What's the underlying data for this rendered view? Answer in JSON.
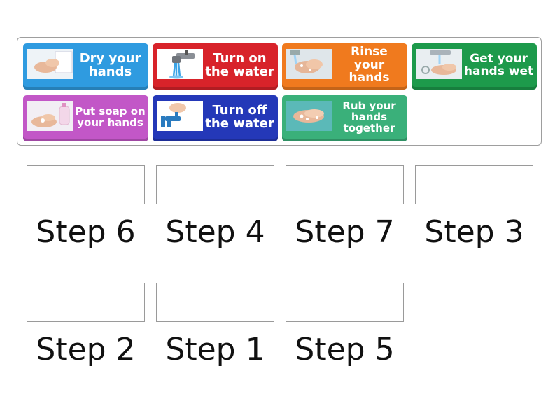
{
  "tiles": [
    {
      "label": "Dry your hands",
      "color": "#2f9be0",
      "icon": "dry-hands-icon"
    },
    {
      "label": "Turn on the water",
      "color": "#d8232a",
      "icon": "faucet-on-icon"
    },
    {
      "label": "Rinse your hands",
      "color": "#f07a1e",
      "icon": "rinse-hands-icon"
    },
    {
      "label": "Get your hands wet",
      "color": "#1d9a4b",
      "icon": "wet-hands-icon"
    },
    {
      "label": "Put soap on your hands",
      "color": "#c257c7",
      "icon": "soap-icon"
    },
    {
      "label": "Turn off the water",
      "color": "#2438b8",
      "icon": "faucet-off-icon"
    },
    {
      "label": "Rub your hands together",
      "color": "#3ab07a",
      "icon": "rub-hands-icon"
    }
  ],
  "slots": [
    {
      "label": "Step 6"
    },
    {
      "label": "Step 4"
    },
    {
      "label": "Step 7"
    },
    {
      "label": "Step 3"
    },
    {
      "label": "Step 2"
    },
    {
      "label": "Step 1"
    },
    {
      "label": "Step 5"
    }
  ]
}
